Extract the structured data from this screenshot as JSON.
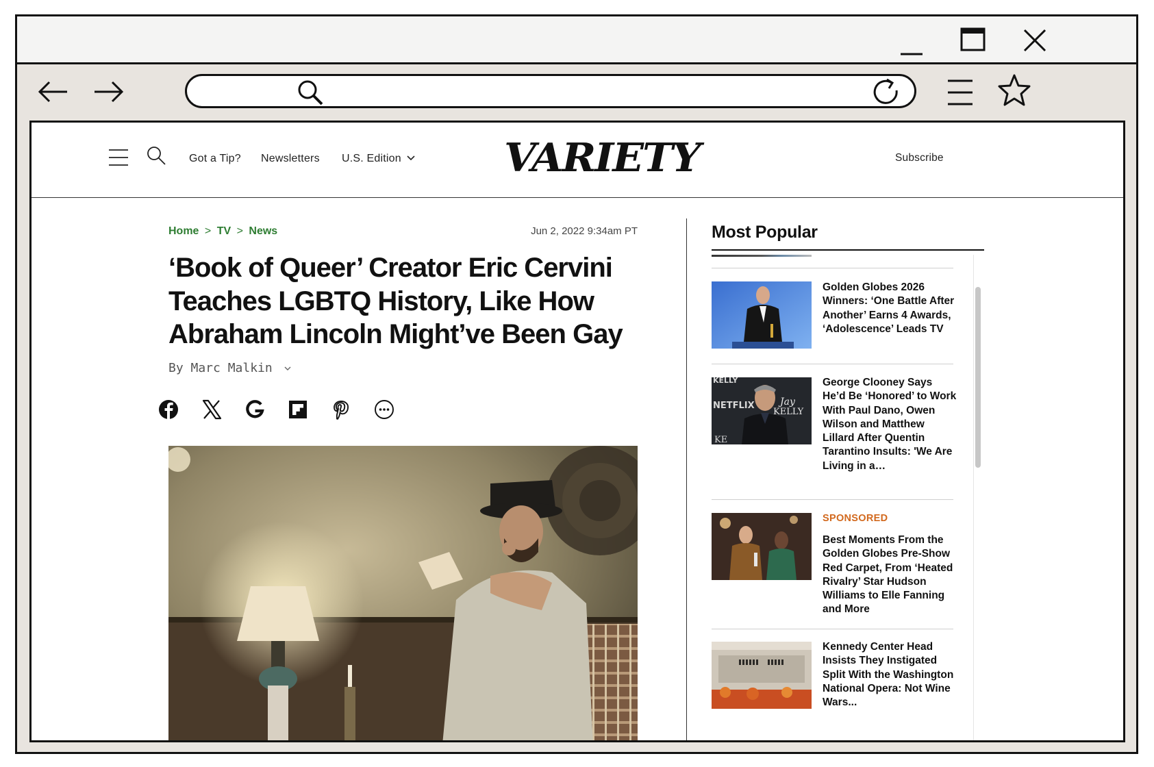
{
  "browser": {
    "window_controls": [
      "minimize-icon",
      "maximize-icon",
      "close-icon"
    ],
    "toolbar_icons": [
      "back-arrow-icon",
      "forward-arrow-icon",
      "search-icon",
      "reload-icon",
      "menu-icon",
      "star-icon"
    ],
    "url_value": ""
  },
  "site": {
    "nav": {
      "tip": "Got a Tip?",
      "newsletters": "Newsletters",
      "edition": "U.S. Edition",
      "subscribe": "Subscribe"
    },
    "logo": "VARIETY"
  },
  "article": {
    "breadcrumb": [
      "Home",
      "TV",
      "News"
    ],
    "breadcrumb_sep": ">",
    "date": "Jun 2, 2022 9:34am PT",
    "headline_lines": [
      "‘Book of Queer’ Creator Eric Cervini",
      "Teaches LGBTQ History, Like How",
      "Abraham Lincoln Might’ve Been Gay"
    ],
    "byline": "By Marc Malkin",
    "share_icons": [
      "facebook-icon",
      "x-icon",
      "google-icon",
      "flipboard-icon",
      "pinterest-icon",
      "more-icon"
    ]
  },
  "most_popular": {
    "title": "Most Popular",
    "items": [
      {
        "text": "Golden Globes 2026 Winners: ‘One Battle After Another’ Earns 4 Awards, ‘Adolescence’ Leads TV"
      },
      {
        "text": "George Clooney Says He’d Be ‘Honored’ to Work With Paul Dano, Owen Wilson and Matthew Lillard After Quentin Tarantino Insults: 'We Are Living in a…"
      },
      {
        "label": "SPONSORED",
        "text": "Best Moments From the Golden Globes Pre-Show Red Carpet, From ‘Heated Rivalry’ Star Hudson Williams to Elle Fanning and More"
      },
      {
        "text": "Kennedy Center Head Insists They Instigated Split With the Washington National Opera: Not Wine Wars..."
      }
    ],
    "thumb_texts": {
      "clooney_poster": [
        "NETFLIX",
        "Jay",
        "KELLY",
        "KELLY",
        "KE"
      ]
    }
  },
  "colors": {
    "breadcrumb": "#2e7d32",
    "sponsored": "#d2691e",
    "window_bg": "#e8e4df"
  }
}
